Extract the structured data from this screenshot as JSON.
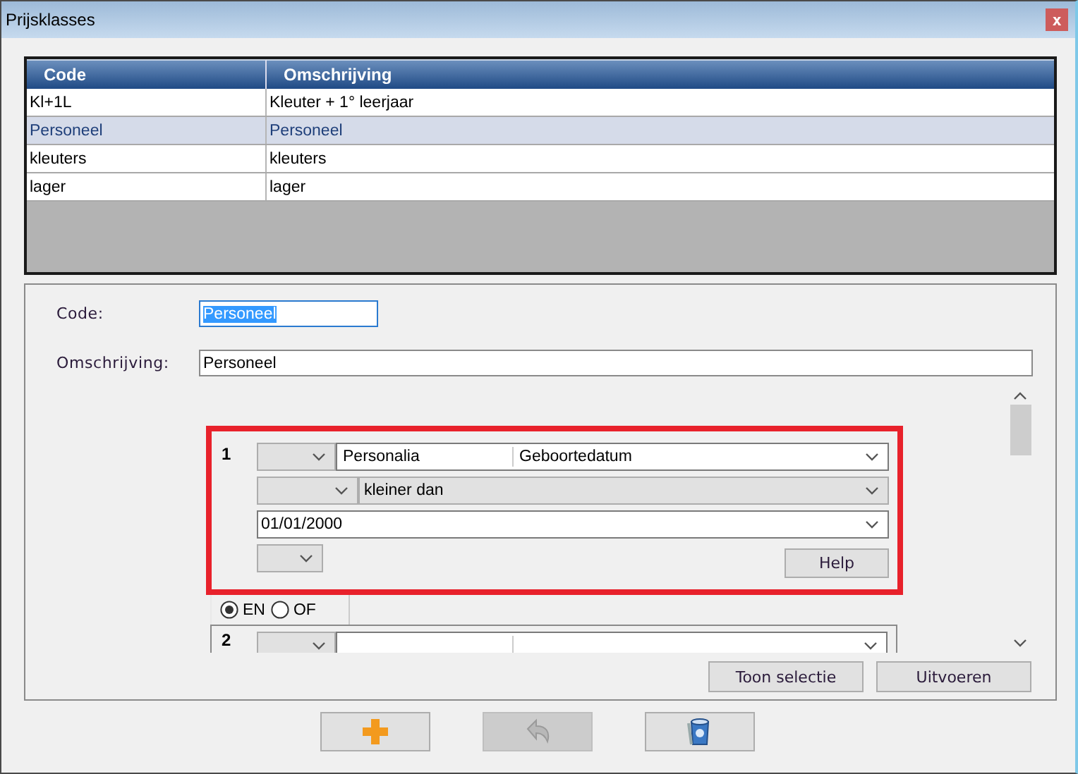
{
  "window": {
    "title": "Prijsklasses",
    "close": "x"
  },
  "table": {
    "columns": [
      "Code",
      "Omschrijving"
    ],
    "rows": [
      {
        "cells": [
          "Kl+1L",
          "Kleuter + 1° leerjaar"
        ],
        "selected": false
      },
      {
        "cells": [
          "Personeel",
          "Personeel"
        ],
        "selected": true
      },
      {
        "cells": [
          "kleuters",
          "kleuters"
        ],
        "selected": false
      },
      {
        "cells": [
          "lager",
          "lager"
        ],
        "selected": false
      }
    ]
  },
  "form": {
    "fields": [
      {
        "label": "Code:",
        "value": "Personeel",
        "text_selected": true
      },
      {
        "label": "Omschrijving:",
        "value": "Personeel",
        "text_selected": false
      }
    ]
  },
  "criteria": [
    {
      "number": "1",
      "highlighted": true,
      "field_group": "Personalia",
      "field": "Geboortedatum",
      "operator": "kleiner dan",
      "value": "01/01/2000",
      "help": "Help"
    },
    {
      "number": "2",
      "highlighted": false
    }
  ],
  "connector": {
    "options": [
      {
        "label": "EN",
        "selected": true
      },
      {
        "label": "OF",
        "selected": false
      }
    ]
  },
  "actions": [
    "Toon selectie",
    "Uitvoeren"
  ],
  "toolbar": [
    {
      "kind": "add",
      "disabled": false
    },
    {
      "kind": "undo",
      "disabled": true
    },
    {
      "kind": "delete",
      "disabled": false
    }
  ]
}
